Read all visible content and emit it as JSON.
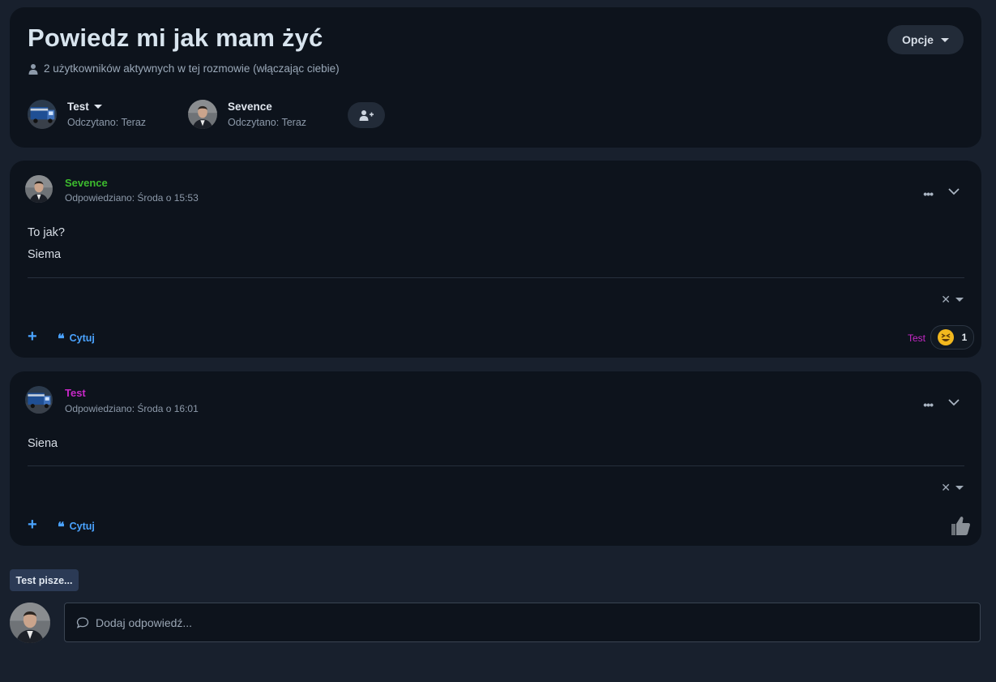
{
  "header": {
    "title": "Powiedz mi jak mam żyć",
    "subtitle": "2 użytkowników aktywnych w tej rozmowie (włączając ciebie)",
    "options_label": "Opcje",
    "participants": [
      {
        "name": "Test",
        "read": "Odczytano: Teraz"
      },
      {
        "name": "Sevence",
        "read": "Odczytano: Teraz"
      }
    ]
  },
  "messages": [
    {
      "author": "Sevence",
      "author_color": "#3dbb2e",
      "time": "Odpowiedziano: Środa o 15:53",
      "lines": [
        "To jak?",
        "Siema"
      ],
      "quote_label": "Cytuj",
      "reaction": {
        "user": "Test",
        "emoji": "grinning-squinting-face",
        "count": "1"
      }
    },
    {
      "author": "Test",
      "author_color": "#c828c8",
      "time": "Odpowiedziano: Środa o 16:01",
      "lines": [
        "Siena"
      ],
      "quote_label": "Cytuj"
    }
  ],
  "typing": "Test pisze...",
  "reply": {
    "placeholder": "Dodaj odpowiedź..."
  }
}
